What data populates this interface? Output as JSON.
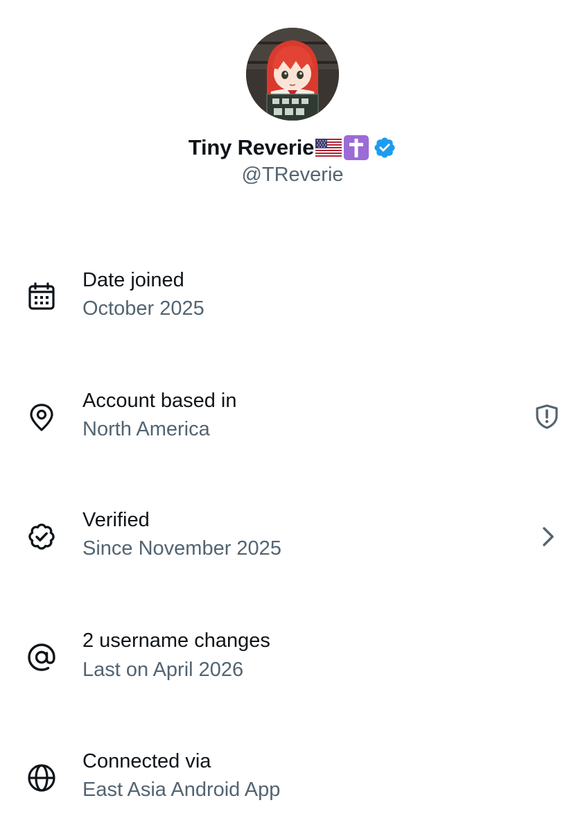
{
  "profile": {
    "display_name": "Tiny Reverie",
    "handle": "@TReverie",
    "name_emojis": [
      "us-flag-icon",
      "latin-cross-icon"
    ],
    "verified": true,
    "verified_color": "#1d9bf0"
  },
  "rows": [
    {
      "icon": "calendar-icon",
      "title": "Date joined",
      "subtitle": "October 2025",
      "trailing": null
    },
    {
      "icon": "location-pin-icon",
      "title": "Account based in",
      "subtitle": "North America",
      "trailing": "shield-alert-icon"
    },
    {
      "icon": "verified-outline-icon",
      "title": "Verified",
      "subtitle": "Since November 2025",
      "trailing": "chevron-right-icon"
    },
    {
      "icon": "at-sign-icon",
      "title": "2 username changes",
      "subtitle": "Last on April 2026",
      "trailing": null
    },
    {
      "icon": "globe-icon",
      "title": "Connected via",
      "subtitle": "East Asia Android App",
      "trailing": null
    }
  ],
  "colors": {
    "primary_text": "#0f1419",
    "secondary_text": "#536471",
    "verified_blue": "#1d9bf0",
    "emoji_purple": "#9b6bd6"
  }
}
